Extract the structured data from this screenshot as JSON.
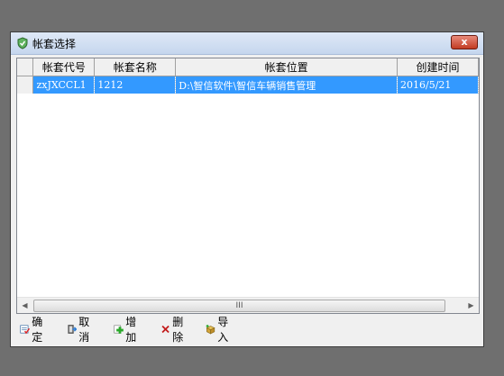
{
  "window": {
    "title": "帐套选择",
    "close_label": "x"
  },
  "grid": {
    "columns": [
      "",
      "帐套代号",
      "帐套名称",
      "帐套位置",
      "创建时间"
    ],
    "rows": [
      {
        "code": "zxJXCCL1",
        "name": "1212",
        "path": "D:\\智信软件\\智信车辆销售管理",
        "date": "2016/5/21",
        "selected": true
      }
    ],
    "scroll_thumb_label": "III"
  },
  "toolbar": {
    "confirm": "确定",
    "cancel": "取消",
    "add": "增加",
    "delete": "删除",
    "import": "导入"
  },
  "colors": {
    "selection": "#3399ff",
    "close": "#c23b22"
  }
}
